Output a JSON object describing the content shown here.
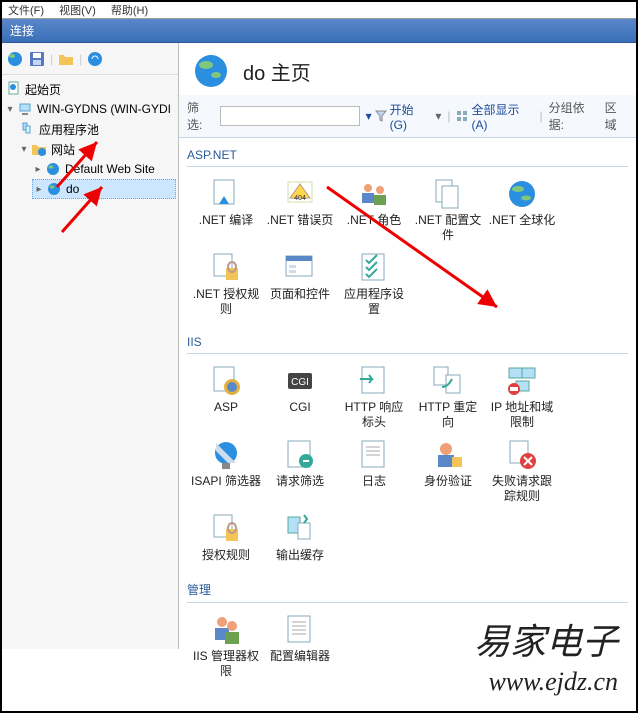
{
  "menubar": [
    "文件(F)",
    "视图(V)",
    "帮助(H)"
  ],
  "connections_label": "连接",
  "tree": {
    "start": "起始页",
    "server": "WIN-GYDNS (WIN-GYDI",
    "apppools": "应用程序池",
    "sites": "网站",
    "default_site": "Default Web Site",
    "do": "do"
  },
  "page_title": "do 主页",
  "filter": {
    "label": "筛选:",
    "go": "开始(G)",
    "show_all": "全部显示(A)",
    "group_by": "分组依据:",
    "group_val": "区域"
  },
  "groups": {
    "aspnet": {
      "title": "ASP.NET",
      "tiles": [
        ".NET 编译",
        ".NET 错误页",
        ".NET 角色",
        ".NET 配置文件",
        ".NET 全球化",
        ".NET 授权规则",
        "页面和控件",
        "应用程序设置"
      ]
    },
    "iis": {
      "title": "IIS",
      "tiles": [
        "ASP",
        "CGI",
        "HTTP 响应标头",
        "HTTP 重定向",
        "IP 地址和域限制",
        "ISAPI 筛选器",
        "请求筛选",
        "日志",
        "身份验证",
        "失败请求跟踪规则",
        "授权规则",
        "输出缓存"
      ]
    },
    "mgmt": {
      "title": "管理",
      "tiles": [
        "IIS 管理器权限",
        "配置编辑器"
      ]
    }
  },
  "watermark": {
    "cn": "易家电子",
    "url": "www.ejdz.cn"
  }
}
